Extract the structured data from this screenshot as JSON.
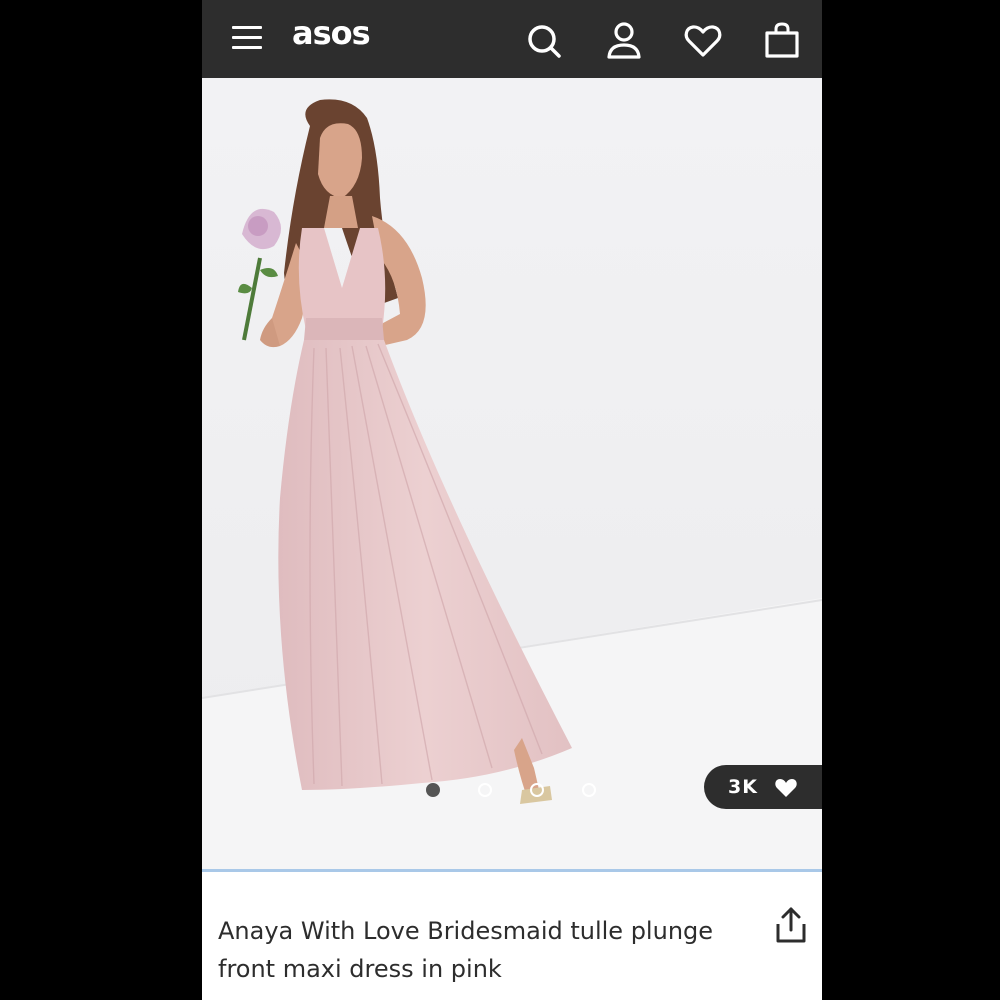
{
  "header": {
    "logo": "asos",
    "icons": [
      "menu-icon",
      "search-icon",
      "account-icon",
      "wishlist-icon",
      "bag-icon"
    ],
    "background": "#2d2d2d"
  },
  "gallery": {
    "image": "Model wearing a pink tulle plunge maxi dress, holding a pink flower",
    "slide_count": 4,
    "active_slide": 1
  },
  "likes": {
    "count": "3K",
    "icon": "heart-icon"
  },
  "product": {
    "title": "Anaya With Love Bridesmaid tulle plunge front maxi dress in pink",
    "share_icon": "share-icon"
  },
  "colors": {
    "accent_divider": "#a9c8e8",
    "dress_pink": "#e6c4c6"
  }
}
